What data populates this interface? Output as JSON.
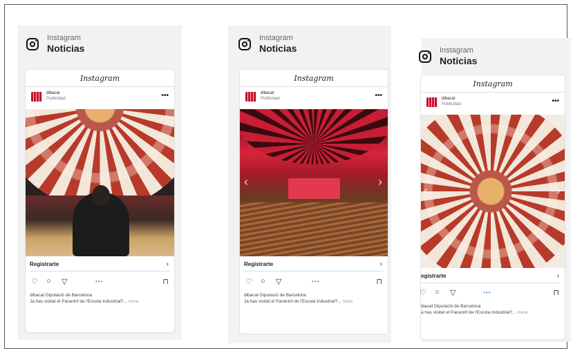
{
  "panels": [
    {
      "app_name": "Instagram",
      "title": "Noticias",
      "brand": "Instagram",
      "account": "dibacat",
      "sponsored": "Publicidad",
      "menu": "•••",
      "cta": "Registrarte",
      "cta_chevron": "›",
      "carousel_dots": "•••",
      "caption_line1": "dibacat Diputació de Barcelona",
      "caption_line2": "Ja has visitat el Paraninf de l'Escola Industrial?...",
      "more": "more"
    },
    {
      "app_name": "Instagram",
      "title": "Noticias",
      "brand": "Instagram",
      "account": "dibacat",
      "sponsored": "Publicidad",
      "menu": "•••",
      "cta": "Registrarte",
      "cta_chevron": "›",
      "carousel_dots": "•••",
      "caption_line1": "dibacat Diputació de Barcelona",
      "caption_line2": "Ja has visitat el Paraninf de l'Escola Industrial?...",
      "more": "more"
    },
    {
      "app_name": "Instagram",
      "title": "Noticias",
      "brand": "Instagram",
      "account": "dibacat",
      "sponsored": "Publicidad",
      "menu": "•••",
      "cta": "egistrarte",
      "cta_chevron": "›",
      "carousel_dots": "•••",
      "caption_line1": "ibacat Diputació de Barcelona",
      "caption_line2": "a has visitat el Paraninf de l'Escola Industrial?...",
      "more": "more"
    }
  ],
  "icons": {
    "heart": "heart-icon",
    "comment": "comment-icon",
    "share": "send-icon",
    "save": "bookmark-icon",
    "logo": "instagram-logo-icon"
  },
  "colors": {
    "brand_red": "#c8102e",
    "dot_blue": "#3897f0",
    "panel_bg": "#f1f2f4"
  }
}
